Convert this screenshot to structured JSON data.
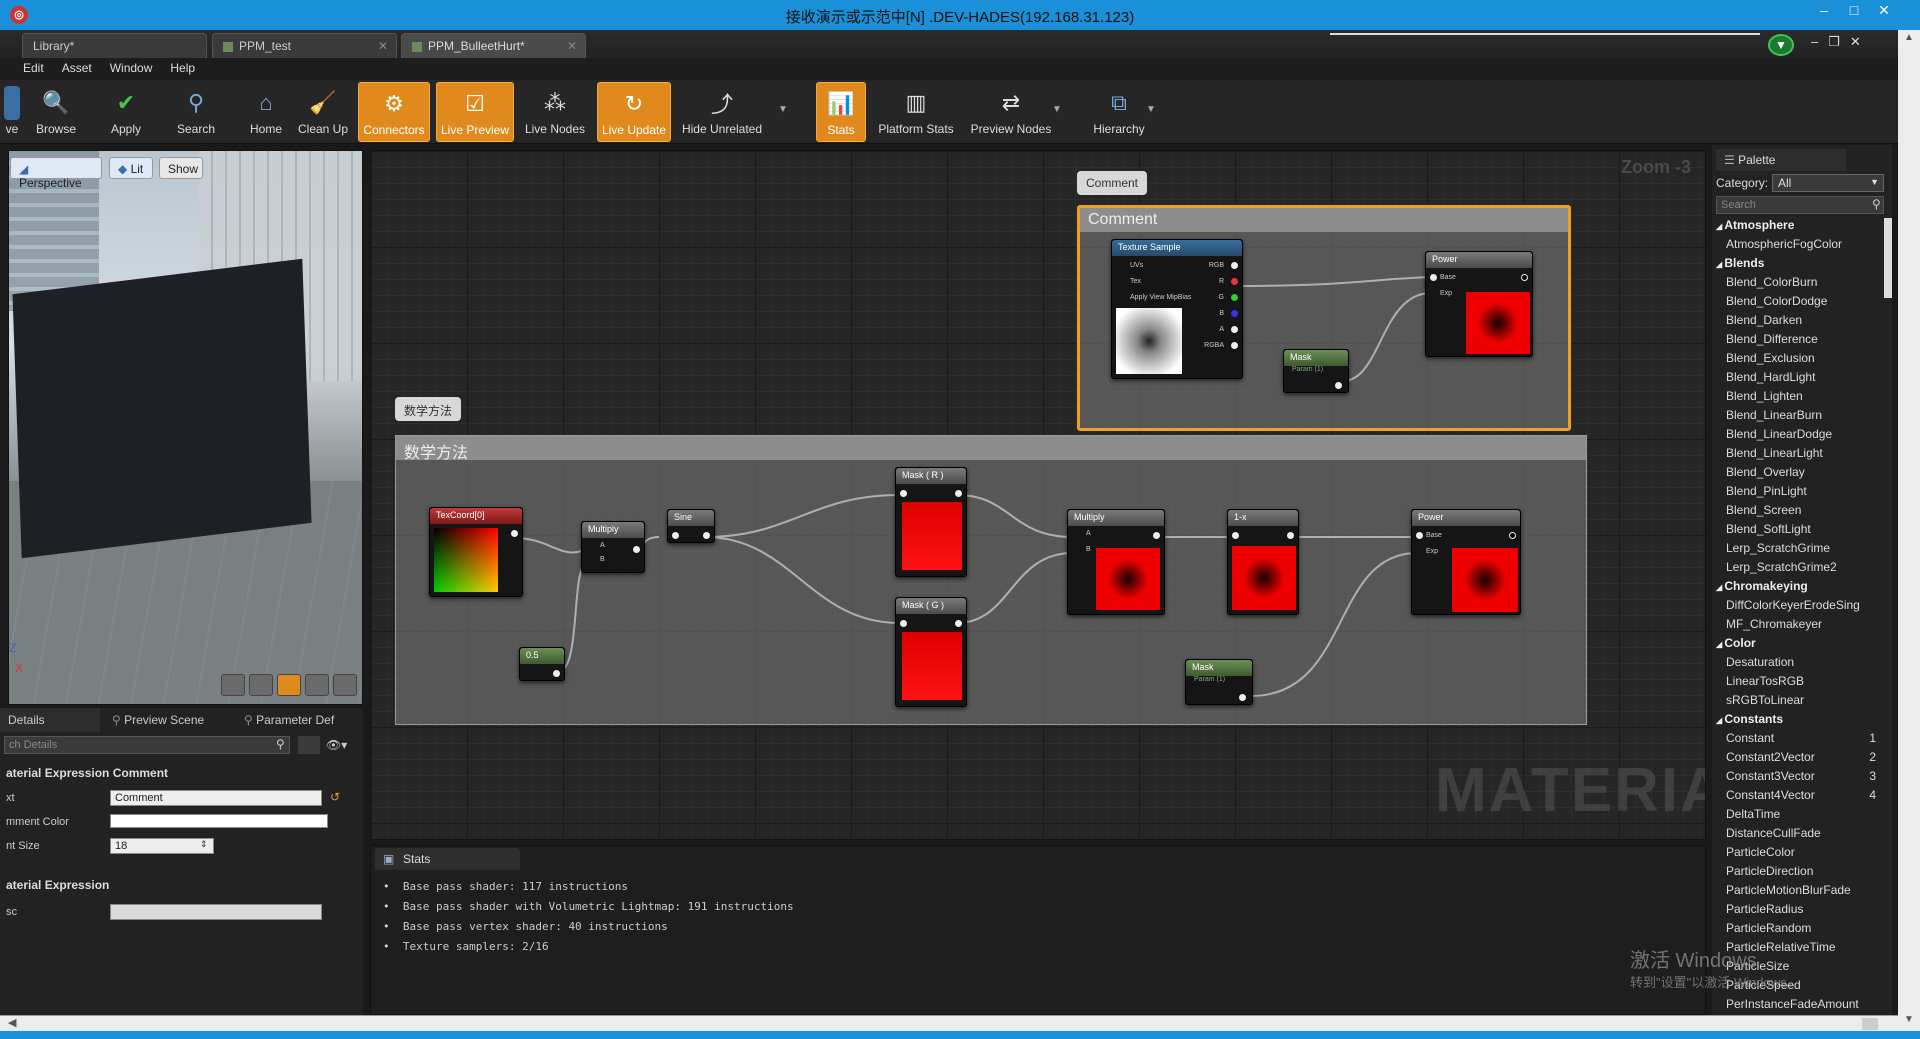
{
  "window": {
    "title": "接收演示或示范中[N] .DEV-HADES(192.168.31.123)",
    "minimize": "–",
    "maximize": "□",
    "close": "✕"
  },
  "tabs": [
    {
      "label": "Library*"
    },
    {
      "label": "PPM_test"
    },
    {
      "label": "PPM_BulleetHurt*"
    }
  ],
  "menu": [
    "Edit",
    "Asset",
    "Window",
    "Help"
  ],
  "toolbar": {
    "items": [
      {
        "label": "ve",
        "icon": "save-icon"
      },
      {
        "label": "Browse",
        "icon": "browse-icon"
      },
      {
        "label": "Apply",
        "icon": "apply-icon"
      },
      {
        "label": "Search",
        "icon": "search-icon"
      },
      {
        "label": "Home",
        "icon": "home-icon"
      },
      {
        "label": "Clean Up",
        "icon": "clean-up-icon"
      },
      {
        "label": "Connectors",
        "icon": "connectors-icon",
        "active": true
      },
      {
        "label": "Live Preview",
        "icon": "live-preview-icon",
        "active": true
      },
      {
        "label": "Live Nodes",
        "icon": "live-nodes-icon"
      },
      {
        "label": "Live Update",
        "icon": "live-update-icon",
        "active": true
      },
      {
        "label": "Hide Unrelated",
        "icon": "hide-unrelated-icon"
      },
      {
        "label": "Stats",
        "icon": "stats-icon",
        "active": true
      },
      {
        "label": "Platform Stats",
        "icon": "platform-stats-icon"
      },
      {
        "label": "Preview Nodes",
        "icon": "preview-nodes-icon"
      },
      {
        "label": "Hierarchy",
        "icon": "hierarchy-icon"
      }
    ]
  },
  "viewport": {
    "perspective": "Perspective",
    "lit": "Lit",
    "show": "Show",
    "axis_z": "Z",
    "axis_x": "X"
  },
  "details": {
    "tabs": [
      "Details",
      "Preview Scene",
      "Parameter Def"
    ],
    "search_placeholder": "ch Details",
    "section1": "aterial Expression Comment",
    "text_label": "xt",
    "text_value": "Comment",
    "color_label": "mment Color",
    "fontsize_label": "nt Size",
    "fontsize_value": "18",
    "section2": "aterial Expression",
    "desc_label": "sc"
  },
  "graph": {
    "zoom": "Zoom -3",
    "watermark": "MATERIAL",
    "comment1": {
      "bubble": "Comment",
      "title": "Comment"
    },
    "comment2": {
      "bubble": "数学方法",
      "title": "数学方法"
    },
    "nodes": {
      "texture_sample": {
        "title": "Texture Sample",
        "pins_in": [
          "UVs",
          "Tex",
          "Apply View MipBias"
        ],
        "pins_out": [
          "RGB",
          "R",
          "G",
          "B",
          "A",
          "RGBA"
        ]
      },
      "power_top": {
        "title": "Power",
        "pins": [
          "Base",
          "Exp"
        ]
      },
      "mask_top": {
        "title": "Mask",
        "sub": "Param (1)"
      },
      "texcoord": {
        "title": "TexCoord[0]"
      },
      "multiply1": {
        "title": "Multiply",
        "pins": [
          "A",
          "B"
        ]
      },
      "sine": {
        "title": "Sine"
      },
      "const": {
        "title": "0.5"
      },
      "mask_r": {
        "title": "Mask ( R )"
      },
      "mask_g": {
        "title": "Mask ( G )"
      },
      "multiply2": {
        "title": "Multiply",
        "pins": [
          "A",
          "B"
        ]
      },
      "oneminus": {
        "title": "1-x"
      },
      "power_bottom": {
        "title": "Power",
        "pins": [
          "Base",
          "Exp"
        ]
      },
      "mask_bottom": {
        "title": "Mask",
        "sub": "Param (1)"
      }
    }
  },
  "stats": {
    "tab": "Stats",
    "lines": [
      "Base pass shader: 117 instructions",
      "Base pass shader with Volumetric Lightmap: 191 instructions",
      "Base pass vertex shader: 40 instructions",
      "Texture samplers: 2/16"
    ]
  },
  "palette": {
    "title": "Palette",
    "category_label": "Category:",
    "category_value": "All",
    "search_placeholder": "Search",
    "rows": [
      {
        "t": "cat",
        "label": "Atmosphere"
      },
      {
        "t": "item",
        "label": "AtmosphericFogColor"
      },
      {
        "t": "cat",
        "label": "Blends"
      },
      {
        "t": "item",
        "label": "Blend_ColorBurn"
      },
      {
        "t": "item",
        "label": "Blend_ColorDodge"
      },
      {
        "t": "item",
        "label": "Blend_Darken"
      },
      {
        "t": "item",
        "label": "Blend_Difference"
      },
      {
        "t": "item",
        "label": "Blend_Exclusion"
      },
      {
        "t": "item",
        "label": "Blend_HardLight"
      },
      {
        "t": "item",
        "label": "Blend_Lighten"
      },
      {
        "t": "item",
        "label": "Blend_LinearBurn"
      },
      {
        "t": "item",
        "label": "Blend_LinearDodge"
      },
      {
        "t": "item",
        "label": "Blend_LinearLight"
      },
      {
        "t": "item",
        "label": "Blend_Overlay"
      },
      {
        "t": "item",
        "label": "Blend_PinLight"
      },
      {
        "t": "item",
        "label": "Blend_Screen"
      },
      {
        "t": "item",
        "label": "Blend_SoftLight"
      },
      {
        "t": "item",
        "label": "Lerp_ScratchGrime"
      },
      {
        "t": "item",
        "label": "Lerp_ScratchGrime2"
      },
      {
        "t": "cat",
        "label": "Chromakeying"
      },
      {
        "t": "item",
        "label": "DiffColorKeyerErodeSing"
      },
      {
        "t": "item",
        "label": "MF_Chromakeyer"
      },
      {
        "t": "cat",
        "label": "Color"
      },
      {
        "t": "item",
        "label": "Desaturation"
      },
      {
        "t": "item",
        "label": "LinearTosRGB"
      },
      {
        "t": "item",
        "label": "sRGBToLinear"
      },
      {
        "t": "cat",
        "label": "Constants"
      },
      {
        "t": "item",
        "label": "Constant",
        "num": "1"
      },
      {
        "t": "item",
        "label": "Constant2Vector",
        "num": "2"
      },
      {
        "t": "item",
        "label": "Constant3Vector",
        "num": "3"
      },
      {
        "t": "item",
        "label": "Constant4Vector",
        "num": "4"
      },
      {
        "t": "item",
        "label": "DeltaTime"
      },
      {
        "t": "item",
        "label": "DistanceCullFade"
      },
      {
        "t": "item",
        "label": "ParticleColor"
      },
      {
        "t": "item",
        "label": "ParticleDirection"
      },
      {
        "t": "item",
        "label": "ParticleMotionBlurFade"
      },
      {
        "t": "item",
        "label": "ParticleRadius"
      },
      {
        "t": "item",
        "label": "ParticleRandom"
      },
      {
        "t": "item",
        "label": "ParticleRelativeTime"
      },
      {
        "t": "item",
        "label": "ParticleSize"
      },
      {
        "t": "item",
        "label": "ParticleSpeed"
      },
      {
        "t": "item",
        "label": "PerInstanceFadeAmount"
      }
    ]
  },
  "activation": {
    "line1": "激活 Windows",
    "line2": "转到\"设置\"以激活 Windows。"
  },
  "colors": {
    "titlebar": "#1a90d8",
    "accent_orange": "#e08a1e",
    "comment_selected": "#f0a020",
    "preview_red": "#e00000"
  }
}
